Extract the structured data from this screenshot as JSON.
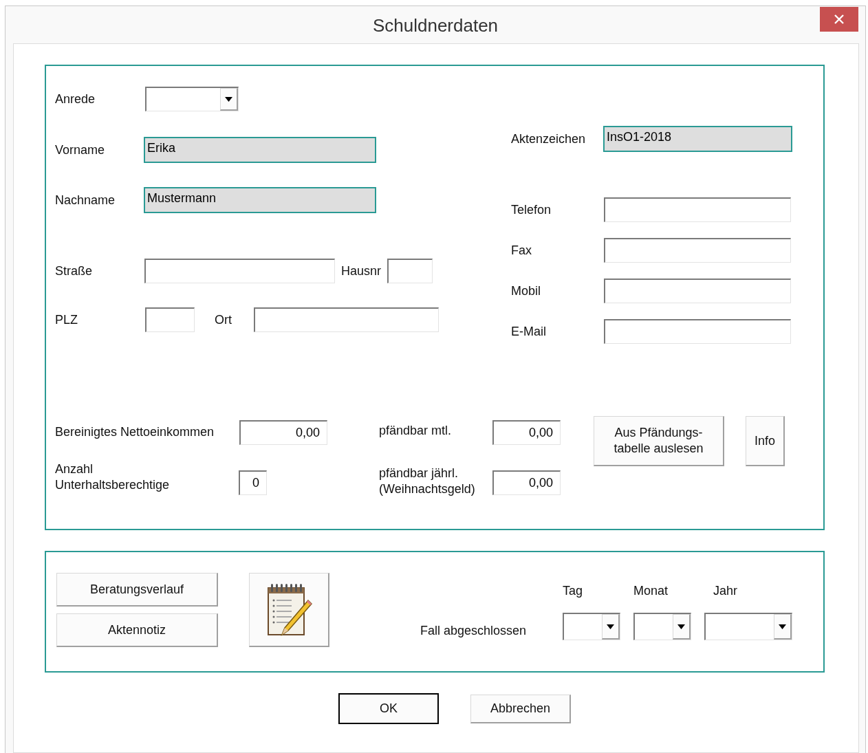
{
  "window": {
    "title": "Schuldnerdaten"
  },
  "person": {
    "anrede": {
      "label": "Anrede"
    },
    "vorname": {
      "label": "Vorname",
      "value": "Erika",
      "readonly": true
    },
    "nachname": {
      "label": "Nachname",
      "value": "Mustermann",
      "readonly": true
    },
    "strasse": {
      "label": "Straße"
    },
    "hausnr": {
      "label": "Hausnr"
    },
    "plz": {
      "label": "PLZ"
    },
    "ort": {
      "label": "Ort"
    }
  },
  "contact": {
    "aktenzeichen": {
      "label": "Aktenzeichen",
      "value": "InsO1-2018",
      "readonly": true
    },
    "fields": [
      {
        "label": "Telefon"
      },
      {
        "label": "Fax"
      },
      {
        "label": "Mobil"
      },
      {
        "label": "E-Mail"
      }
    ]
  },
  "income": {
    "netto": {
      "label": "Bereinigtes Nettoeinkommen",
      "value": "0,00"
    },
    "unterhalt": {
      "label": "Anzahl\nUnterhaltsberechtige",
      "value": "0"
    },
    "monthly": {
      "label": "pfändbar mtl.",
      "value": "0,00"
    },
    "yearly": {
      "label": "pfändbar jährl.\n(Weihnachtsgeld)",
      "value": "0,00"
    },
    "buttons": [
      "Aus Pfändungs-\ntabelle auslesen",
      "Info"
    ]
  },
  "case": {
    "buttons": [
      "Beratungsverlauf",
      "Aktennotiz"
    ],
    "closed_label": "Fall abgeschlossen",
    "date": [
      {
        "label": "Tag"
      },
      {
        "label": "Monat"
      },
      {
        "label": "Jahr"
      }
    ]
  },
  "footer": {
    "buttons": [
      {
        "label": "OK",
        "default": true
      },
      {
        "label": "Abbrechen",
        "default": false
      }
    ]
  }
}
